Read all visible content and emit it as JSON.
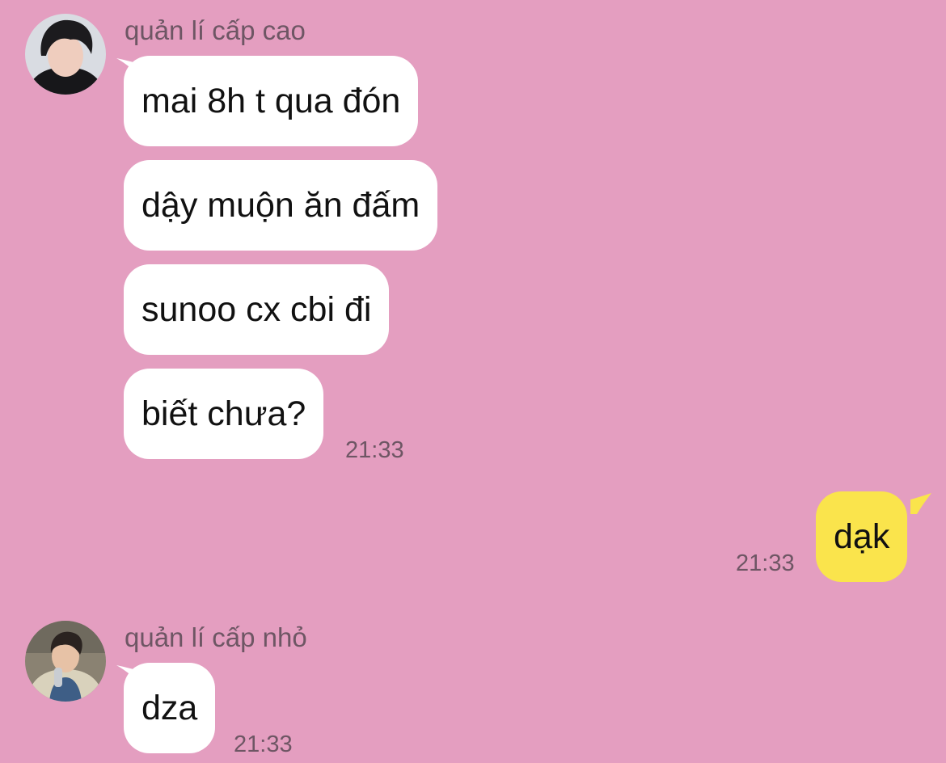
{
  "colors": {
    "background": "#E49EC0",
    "incoming_bubble": "#FFFFFF",
    "outgoing_bubble": "#FAE44C",
    "meta_text": "#6E5664"
  },
  "groups": [
    {
      "sender": "quản lí cấp cao",
      "avatar_icon": "user-avatar-photo",
      "messages": [
        "mai 8h t qua đón",
        "dậy muộn ăn đấm",
        "sunoo cx cbi đi",
        "biết chưa?"
      ],
      "time": "21:33"
    },
    {
      "outgoing": true,
      "messages": [
        "dạk"
      ],
      "time": "21:33"
    },
    {
      "sender": "quản lí cấp nhỏ",
      "avatar_icon": "user-avatar-photo",
      "messages": [
        "dza"
      ],
      "time": "21:33"
    }
  ]
}
